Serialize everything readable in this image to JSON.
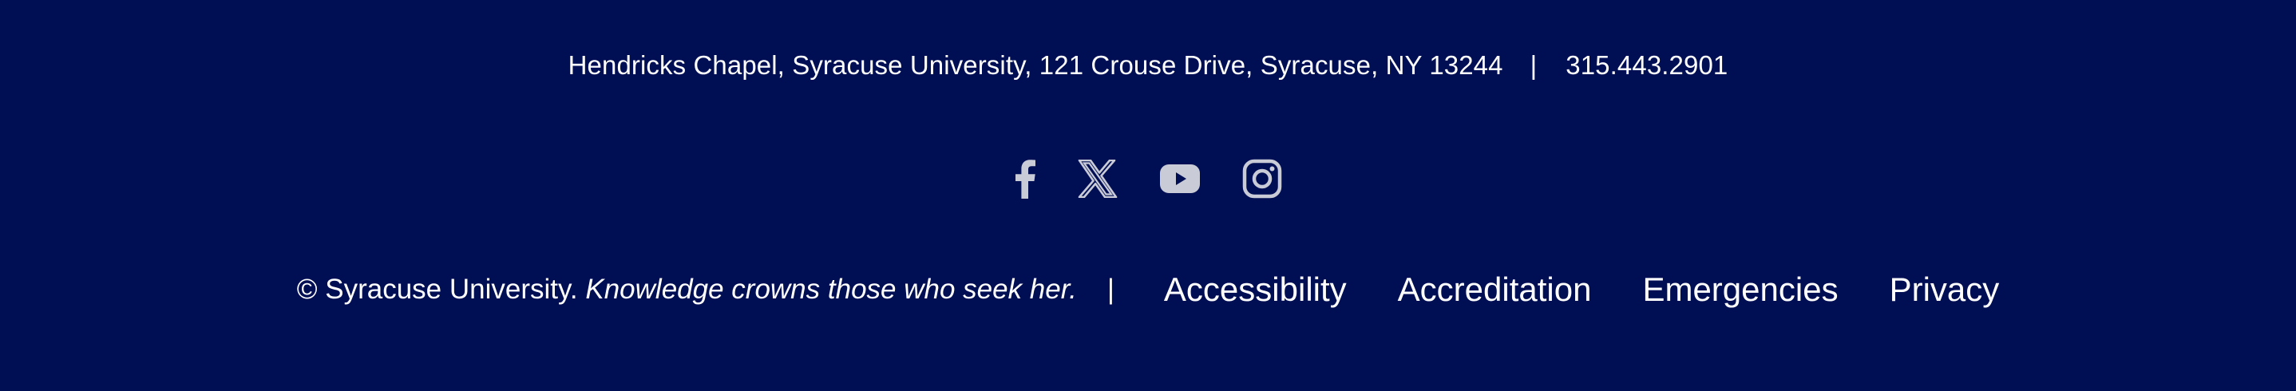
{
  "footer": {
    "address": "Hendricks Chapel, Syracuse University, 121 Crouse Drive, Syracuse, NY 13244",
    "separator": "|",
    "phone": "315.443.2901",
    "social": [
      {
        "name": "facebook-icon"
      },
      {
        "name": "x-twitter-icon"
      },
      {
        "name": "youtube-icon"
      },
      {
        "name": "instagram-icon"
      }
    ],
    "copyright_prefix": "© Syracuse University.",
    "motto": "Knowledge crowns those who seek her.",
    "links": {
      "accessibility": "Accessibility",
      "accreditation": "Accreditation",
      "emergencies": "Emergencies",
      "privacy": "Privacy"
    }
  },
  "colors": {
    "background": "#000e54",
    "text": "#ffffff",
    "icon": "#c9cbd6"
  }
}
